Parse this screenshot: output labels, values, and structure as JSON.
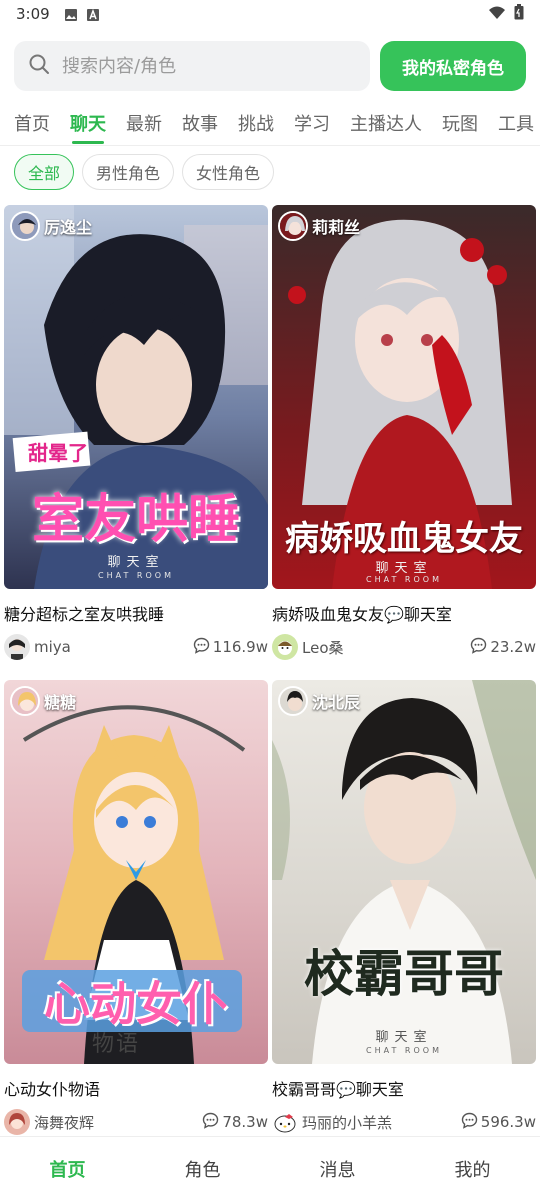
{
  "status_bar": {
    "time": "3:09"
  },
  "search": {
    "placeholder": "搜索内容/角色",
    "private_button": "我的私密角色"
  },
  "tabs": [
    {
      "label": "首页"
    },
    {
      "label": "聊天"
    },
    {
      "label": "最新"
    },
    {
      "label": "故事"
    },
    {
      "label": "挑战"
    },
    {
      "label": "学习"
    },
    {
      "label": "主播达人"
    },
    {
      "label": "玩图"
    },
    {
      "label": "工具"
    }
  ],
  "active_tab": "聊天",
  "filters": [
    {
      "label": "全部"
    },
    {
      "label": "男性角色"
    },
    {
      "label": "女性角色"
    }
  ],
  "cards": [
    {
      "character": "厉逸尘",
      "cover_title_top": "甜晕了",
      "cover_title": "室友哄睡",
      "cover_sub": "聊天室",
      "cover_sub2": "CHAT ROOM",
      "title": "糖分超标之室友哄我睡",
      "author": "miya",
      "count": "116.9w"
    },
    {
      "character": "莉莉丝",
      "cover_title": "病娇吸血鬼女友",
      "cover_sub": "聊天室",
      "cover_sub2": "CHAT ROOM",
      "title": "病娇吸血鬼女友💬聊天室",
      "author": "Leo桑",
      "count": "23.2w"
    },
    {
      "character": "糖糖",
      "cover_title": "心动女仆",
      "cover_sub": "物语",
      "title": "心动女仆物语",
      "author": "海舞夜辉",
      "count": "78.3w"
    },
    {
      "character": "沈北辰",
      "cover_title": "校霸哥哥",
      "cover_sub": "聊天室",
      "cover_sub2": "CHAT ROOM",
      "title": "校霸哥哥💬聊天室",
      "author": "玛丽的小羊羔",
      "count": "596.3w"
    }
  ],
  "bottom_nav": [
    {
      "label": "首页"
    },
    {
      "label": "角色"
    },
    {
      "label": "消息"
    },
    {
      "label": "我的"
    }
  ],
  "colors": {
    "accent": "#36c35a",
    "accent_text": "#2db84f"
  },
  "icons": [
    "image-icon",
    "notification-a-icon",
    "wifi-icon",
    "battery-icon",
    "search-icon",
    "chat-bubble-icon"
  ]
}
